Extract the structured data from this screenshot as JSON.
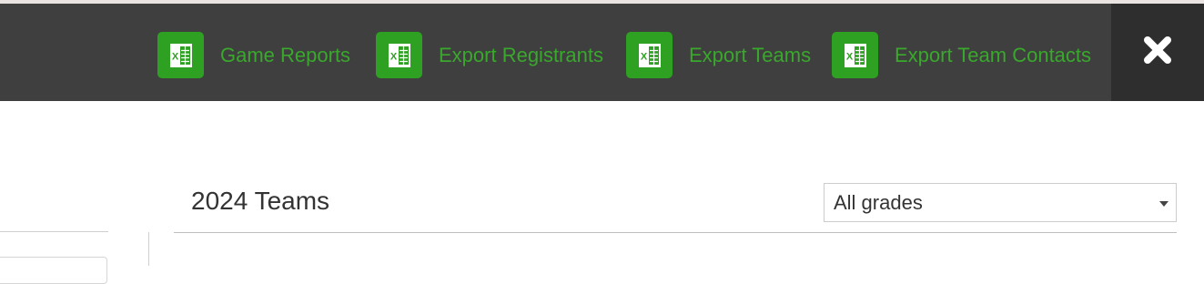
{
  "colors": {
    "toolbar_bg": "#3f3f3f",
    "close_bg": "#2e2e2e",
    "excel_green": "#2ea022",
    "export_label": "#39a82c"
  },
  "toolbar": {
    "exports": [
      {
        "label": "Game Reports",
        "icon": "excel-icon"
      },
      {
        "label": "Export Registrants",
        "icon": "excel-icon"
      },
      {
        "label": "Export Teams",
        "icon": "excel-icon"
      },
      {
        "label": "Export Team Contacts",
        "icon": "excel-icon"
      }
    ],
    "close_icon": "close-x-icon"
  },
  "main": {
    "title": "2024 Teams",
    "grade_filter": {
      "selected": "All grades",
      "icon": "chevron-down-icon"
    }
  }
}
